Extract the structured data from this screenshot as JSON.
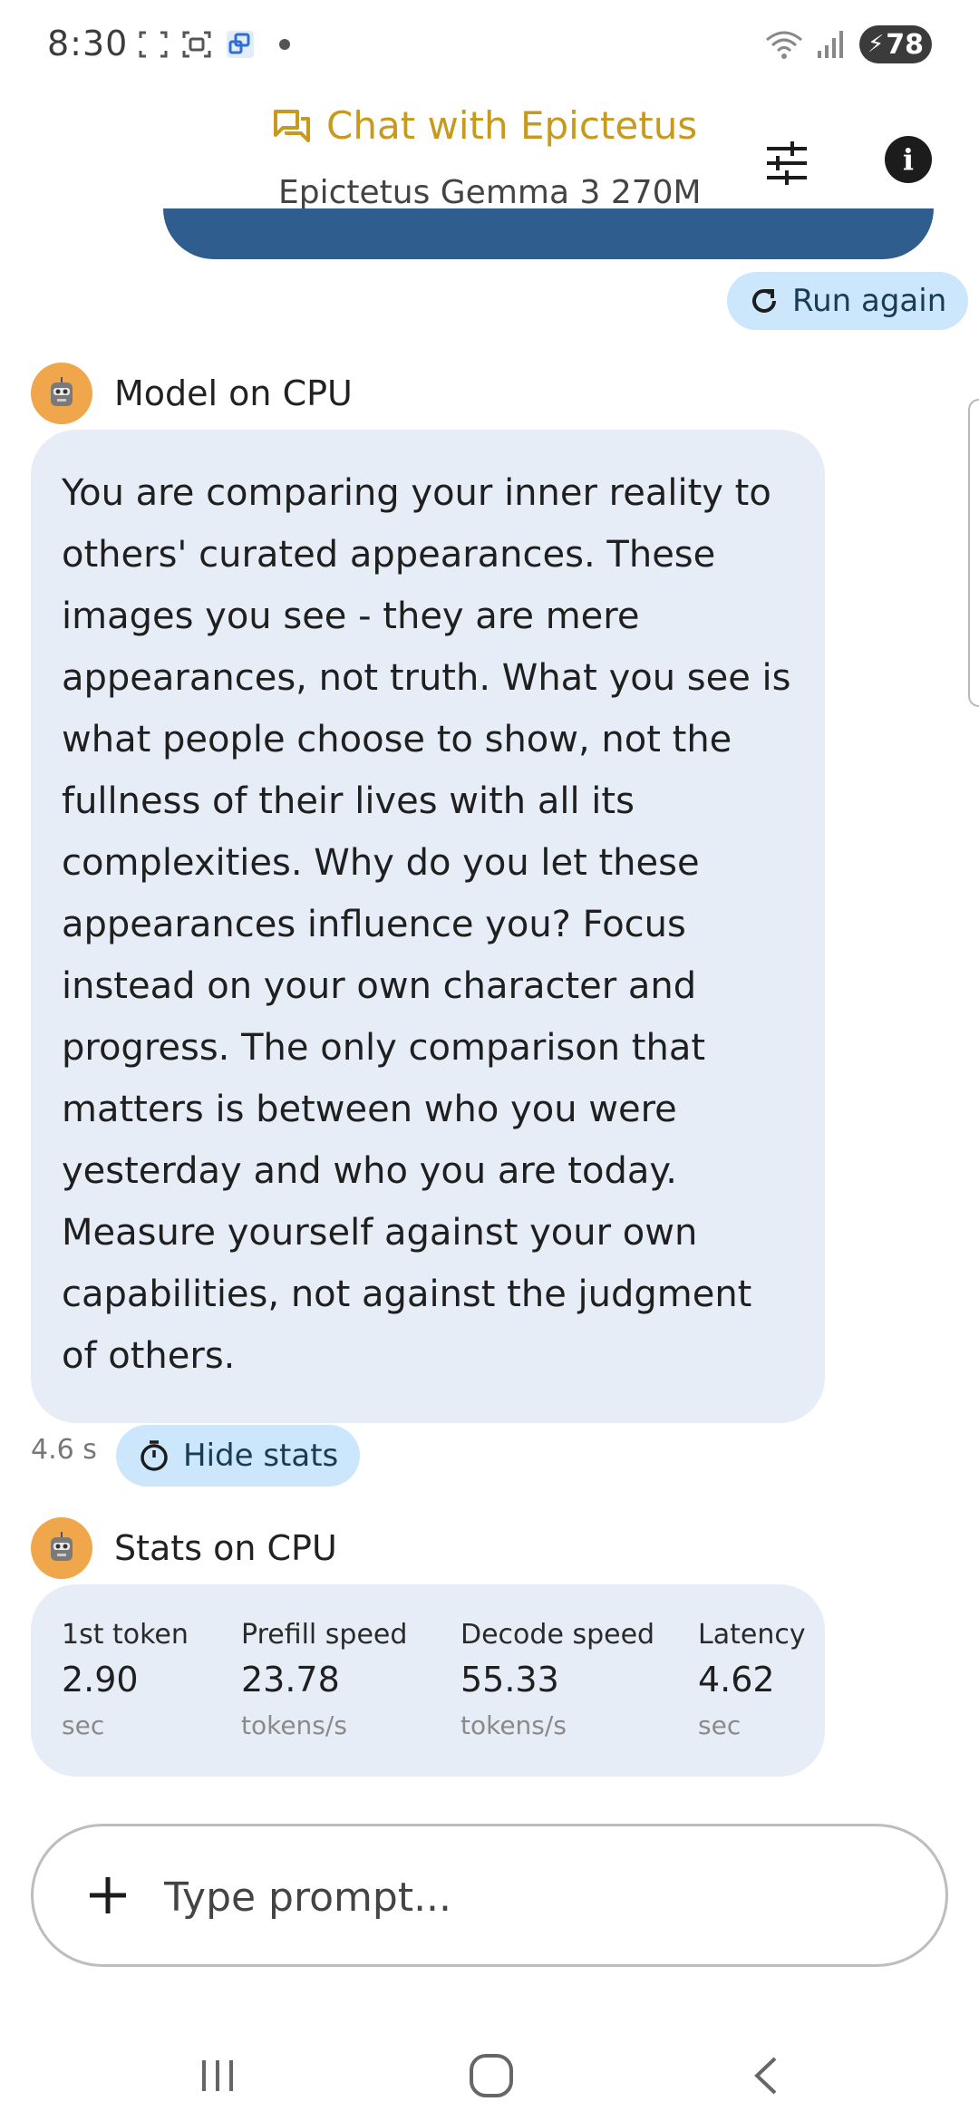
{
  "status_bar": {
    "time": "8:30",
    "battery": "78"
  },
  "header": {
    "title": "Chat with Epictetus",
    "subtitle": "Epictetus Gemma 3 270M",
    "accent_color": "#c79a1e"
  },
  "actions": {
    "run_again_label": "Run again",
    "hide_stats_label": "Hide stats"
  },
  "model_message": {
    "sender": "Model on CPU",
    "text": "You are comparing your inner reality to others' curated appearances. These images you see - they are mere appearances, not truth. What you see is what people choose to show, not the fullness of their lives with all its complexities. Why do you let these appearances influence you? Focus instead on your own character and progress. The only comparison that matters is between who you were yesterday and who you are today. Measure yourself against your own capabilities, not against the judgment of others.",
    "elapsed": "4.6 s"
  },
  "stats": {
    "sender": "Stats on CPU",
    "items": [
      {
        "label": "1st token",
        "value": "2.90",
        "unit": "sec"
      },
      {
        "label": "Prefill speed",
        "value": "23.78",
        "unit": "tokens/s"
      },
      {
        "label": "Decode speed",
        "value": "55.33",
        "unit": "tokens/s"
      },
      {
        "label": "Latency",
        "value": "4.62",
        "unit": "sec"
      }
    ]
  },
  "prompt": {
    "placeholder": "Type prompt..."
  },
  "icons": [
    "screenshot-icon",
    "screen-record-icon",
    "cast-icon",
    "wifi-icon",
    "signal-icon",
    "battery-icon",
    "chat-icon",
    "tune-icon",
    "info-icon",
    "refresh-icon",
    "robot-avatar-icon",
    "timer-icon",
    "plus-icon",
    "recents-icon",
    "home-icon",
    "back-icon"
  ]
}
